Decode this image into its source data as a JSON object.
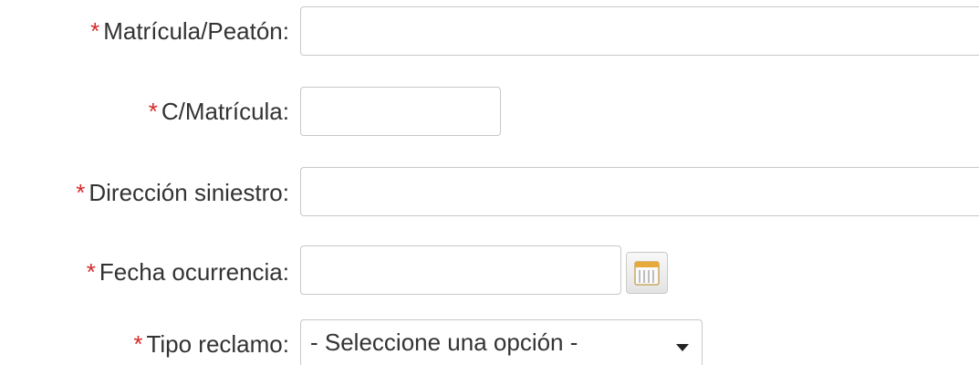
{
  "form": {
    "plate": {
      "required_mark": "*",
      "label": "Matrícula/Peatón:",
      "value": ""
    },
    "confirm_plate": {
      "required_mark": "*",
      "label": "C/Matrícula:",
      "value": ""
    },
    "address": {
      "required_mark": "*",
      "label": "Dirección siniestro:",
      "value": ""
    },
    "date": {
      "required_mark": "*",
      "label": "Fecha ocurrencia:",
      "value": "",
      "icon": "calendar-icon"
    },
    "claim_type": {
      "required_mark": "*",
      "label": "Tipo reclamo:",
      "selected": "- Seleccione una opción -",
      "icon": "chevron-down-icon"
    }
  },
  "colors": {
    "required": "#d42a2a",
    "label": "#333333",
    "border": "#c8c8c8"
  }
}
